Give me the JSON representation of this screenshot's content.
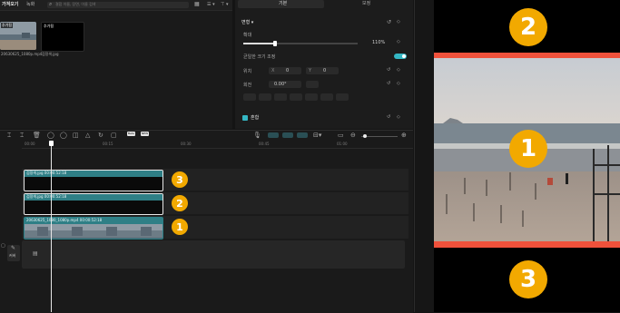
{
  "media": {
    "tabs": [
      "가져오기",
      "녹화"
    ],
    "search_placeholder": "결합 이름, 장면, 이름 검색",
    "sort_label": "모두",
    "items": [
      {
        "name": "20630625_1080p.mp4",
        "badge": "추가됨"
      },
      {
        "name": "검정색.jpg",
        "badge": "추가됨"
      }
    ]
  },
  "inspector": {
    "tabs": [
      "기본",
      "보정"
    ],
    "section_transform": "변형",
    "scale_label": "확대",
    "scale_value": "110%",
    "uniform_scale_label": "균일한 크기 조정",
    "position_label": "위치",
    "x_label": "X",
    "x_value": "0",
    "y_label": "Y",
    "y_value": "0",
    "rotate_label": "회전",
    "rotate_value": "0.00°",
    "blend_label": "혼합",
    "align_icons": [
      "align-left-icon",
      "align-center-h-icon",
      "align-right-icon",
      "align-top-icon",
      "align-center-v-icon",
      "align-bottom-icon",
      "distribute-icon"
    ]
  },
  "timeline": {
    "ruler": [
      "00:00",
      "00:15",
      "00:30",
      "00:45",
      "01:00"
    ],
    "toolbar_badges": [
      "Beta",
      "NEW"
    ],
    "tracks": [
      {
        "label": "검정색.jpg  00:00:52:18",
        "marker": "3"
      },
      {
        "label": "검정색.jpg  00:00:52:18",
        "marker": "2"
      },
      {
        "label": "20630625_1080_1080p.mp4  00:00:52:18",
        "marker": "1"
      }
    ],
    "cover_label": "커버"
  },
  "preview": {
    "markers": [
      "2",
      "1",
      "3"
    ],
    "accent_color": "#f0513b",
    "badge_color": "#f2a900"
  }
}
